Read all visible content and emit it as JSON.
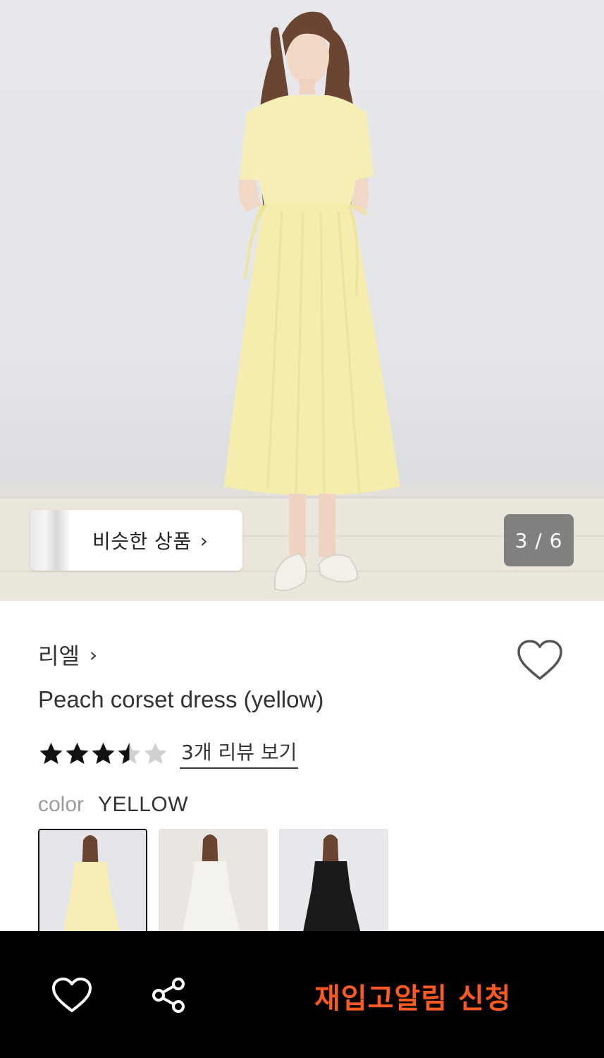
{
  "gallery": {
    "similar_products_label": "비슷한 상품",
    "similar_chevron": "›",
    "page_counter": "3 / 6",
    "current_page": 3,
    "total_pages": 6
  },
  "product": {
    "brand": "리엘",
    "brand_chevron": "›",
    "title": "Peach corset dress (yellow)",
    "rating": 3.5,
    "rating_max": 5,
    "review_link": "3개 리뷰 보기",
    "color_label": "color",
    "color_value": "YELLOW",
    "color_options": [
      {
        "name": "yellow",
        "selected": true,
        "dress_color": "#f6eeb4"
      },
      {
        "name": "ivory",
        "selected": false,
        "dress_color": "#f4f2ec"
      },
      {
        "name": "black",
        "selected": false,
        "dress_color": "#1a1a1a"
      }
    ]
  },
  "bottom_bar": {
    "restock_alert_label": "재입고알림 신청",
    "cta_color": "#ff5a1f",
    "icons": [
      "heart-icon",
      "share-icon"
    ]
  },
  "colors": {
    "dress": "#f5eeb0",
    "background": "#ffffff",
    "bar": "#000000"
  }
}
